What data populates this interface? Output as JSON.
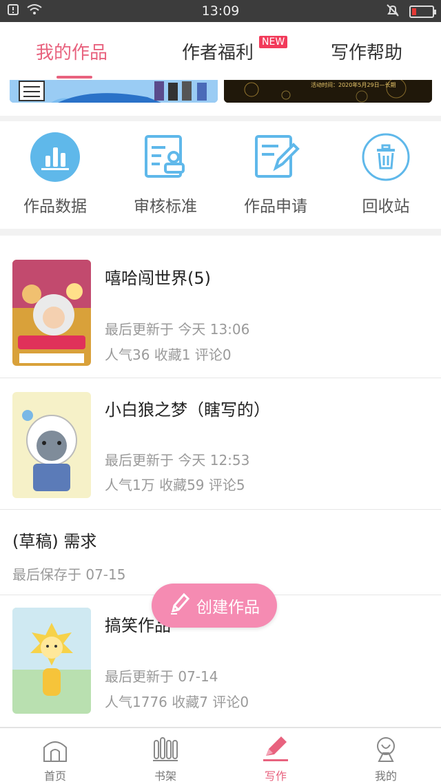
{
  "status_bar": {
    "time": "13:09"
  },
  "tabs": [
    {
      "label": "我的作品",
      "active": true
    },
    {
      "label": "作者福利",
      "badge": "NEW"
    },
    {
      "label": "写作帮助"
    }
  ],
  "banners": {
    "right_caption": "活动时间：2020年5月29日—长期"
  },
  "tools": [
    {
      "label": "作品数据",
      "icon": "bar-chart-icon"
    },
    {
      "label": "审核标准",
      "icon": "review-standard-icon"
    },
    {
      "label": "作品申请",
      "icon": "edit-document-icon"
    },
    {
      "label": "回收站",
      "icon": "trash-icon"
    }
  ],
  "works": [
    {
      "title": "嘻哈闯世界(5)",
      "updated": "最后更新于 今天 13:06",
      "stats": "人气36  收藏1  评论0"
    },
    {
      "title": "小白狼之梦（瞎写的）",
      "updated": "最后更新于 今天 12:53",
      "stats": "人气1万  收藏59  评论5"
    },
    {
      "title": "(草稿) 需求",
      "updated": "最后保存于 07-15"
    },
    {
      "title": "搞笑作品",
      "updated": "最后更新于 07-14",
      "stats": "人气1776  收藏7  评论0"
    }
  ],
  "fab": {
    "label": "创建作品"
  },
  "bottom_nav": [
    {
      "label": "首页"
    },
    {
      "label": "书架"
    },
    {
      "label": "写作",
      "active": true
    },
    {
      "label": "我的"
    }
  ],
  "colors": {
    "accent": "#e8627e",
    "fab": "#f58bb2",
    "icon_blue": "#5fb8ea"
  }
}
